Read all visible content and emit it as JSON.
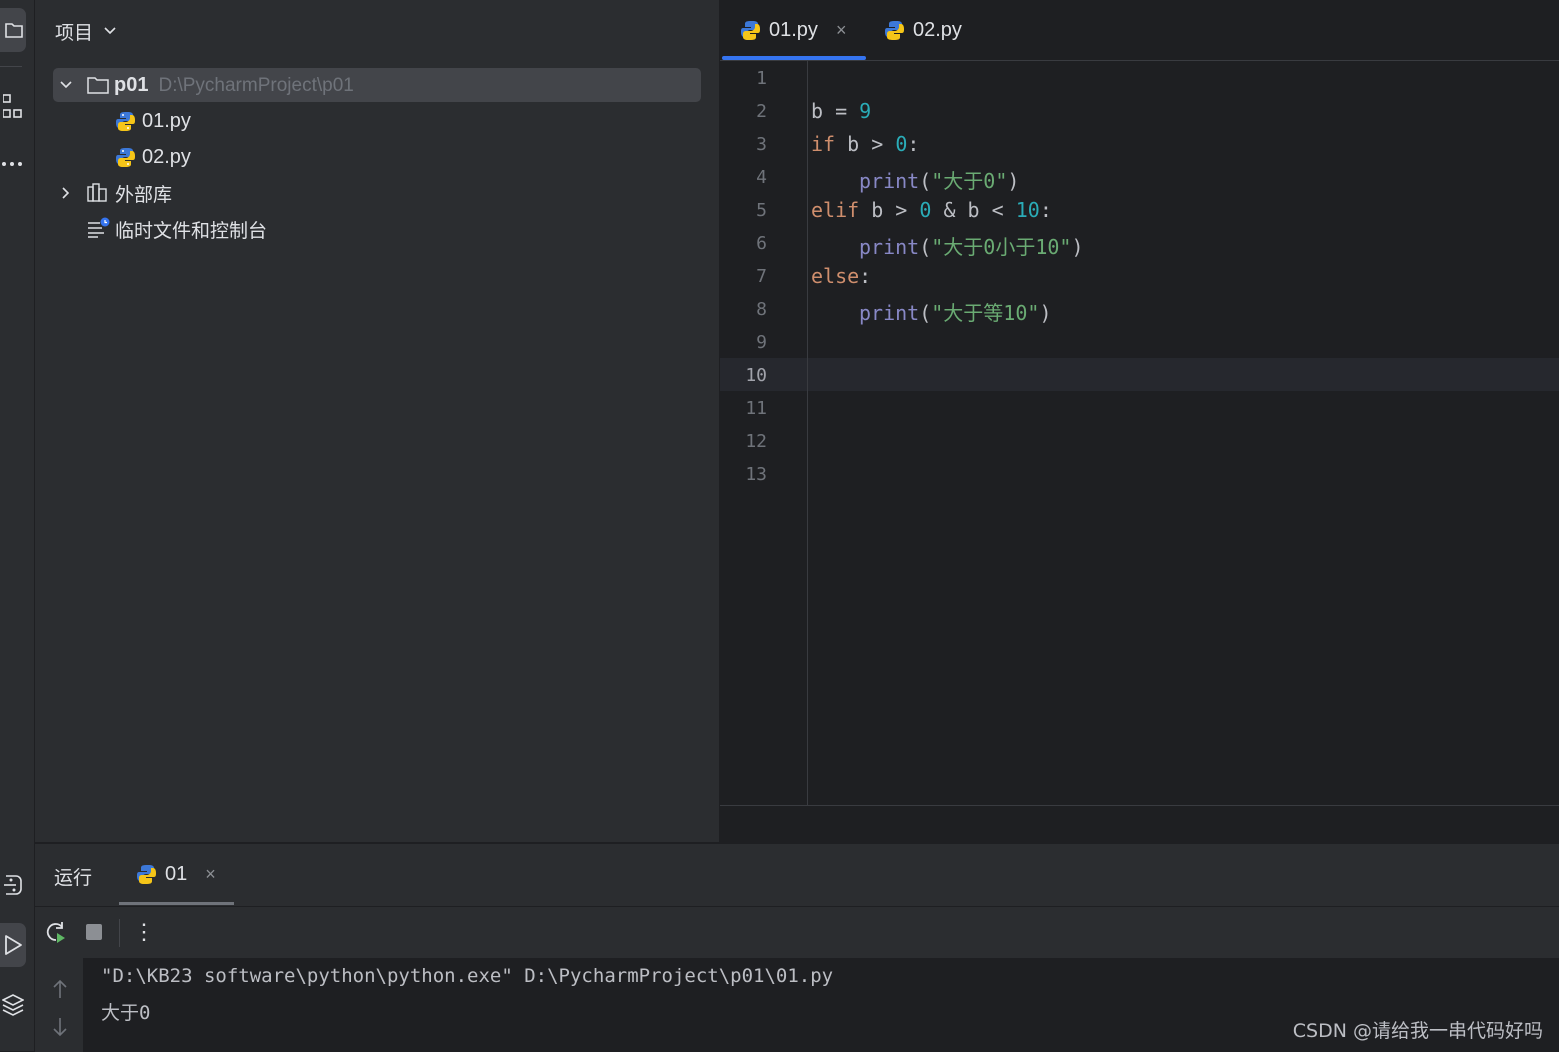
{
  "project_panel": {
    "title": "项目",
    "tree": {
      "root_name": "p01",
      "root_path": "D:\\PycharmProject\\p01",
      "files": [
        "01.py",
        "02.py"
      ],
      "external_libraries": "外部库",
      "scratches": "临时文件和控制台"
    }
  },
  "editor": {
    "tabs": [
      {
        "label": "01.py",
        "active": true,
        "close": "×"
      },
      {
        "label": "02.py",
        "active": false
      }
    ],
    "line_numbers": [
      "1",
      "2",
      "3",
      "4",
      "5",
      "6",
      "7",
      "8",
      "9",
      "10",
      "11",
      "12",
      "13"
    ],
    "current_line": "10",
    "code": {
      "l2": {
        "var": "b",
        "op": " = ",
        "num": "9"
      },
      "l3": {
        "kw": "if",
        "mid": " b > ",
        "num": "0",
        "tail": ":"
      },
      "l4": {
        "fn": "print",
        "open": "(",
        "str": "\"大于0\"",
        "close": ")"
      },
      "l5": {
        "kw": "elif",
        "mid1": " b > ",
        "num1": "0",
        "mid2": " & b < ",
        "num2": "10",
        "tail": ":"
      },
      "l6": {
        "fn": "print",
        "open": "(",
        "str": "\"大于0小于10\"",
        "close": ")"
      },
      "l7": {
        "kw": "else",
        "tail": ":"
      },
      "l8": {
        "fn": "print",
        "open": "(",
        "str": "\"大于等10\"",
        "close": ")"
      }
    }
  },
  "run_panel": {
    "title": "运行",
    "tab_label": "01",
    "tab_close": "×",
    "console_lines": [
      "\"D:\\KB23 software\\python\\python.exe\" D:\\PycharmProject\\p01\\01.py",
      "大于0"
    ],
    "more_icon": "⋮"
  },
  "watermark": "CSDN @请给我一串代码好吗",
  "colors": {
    "accent": "#3574f0",
    "keyword": "#cf8e6d",
    "number": "#2aacb8",
    "builtin": "#8888c6",
    "string": "#6aab73"
  }
}
